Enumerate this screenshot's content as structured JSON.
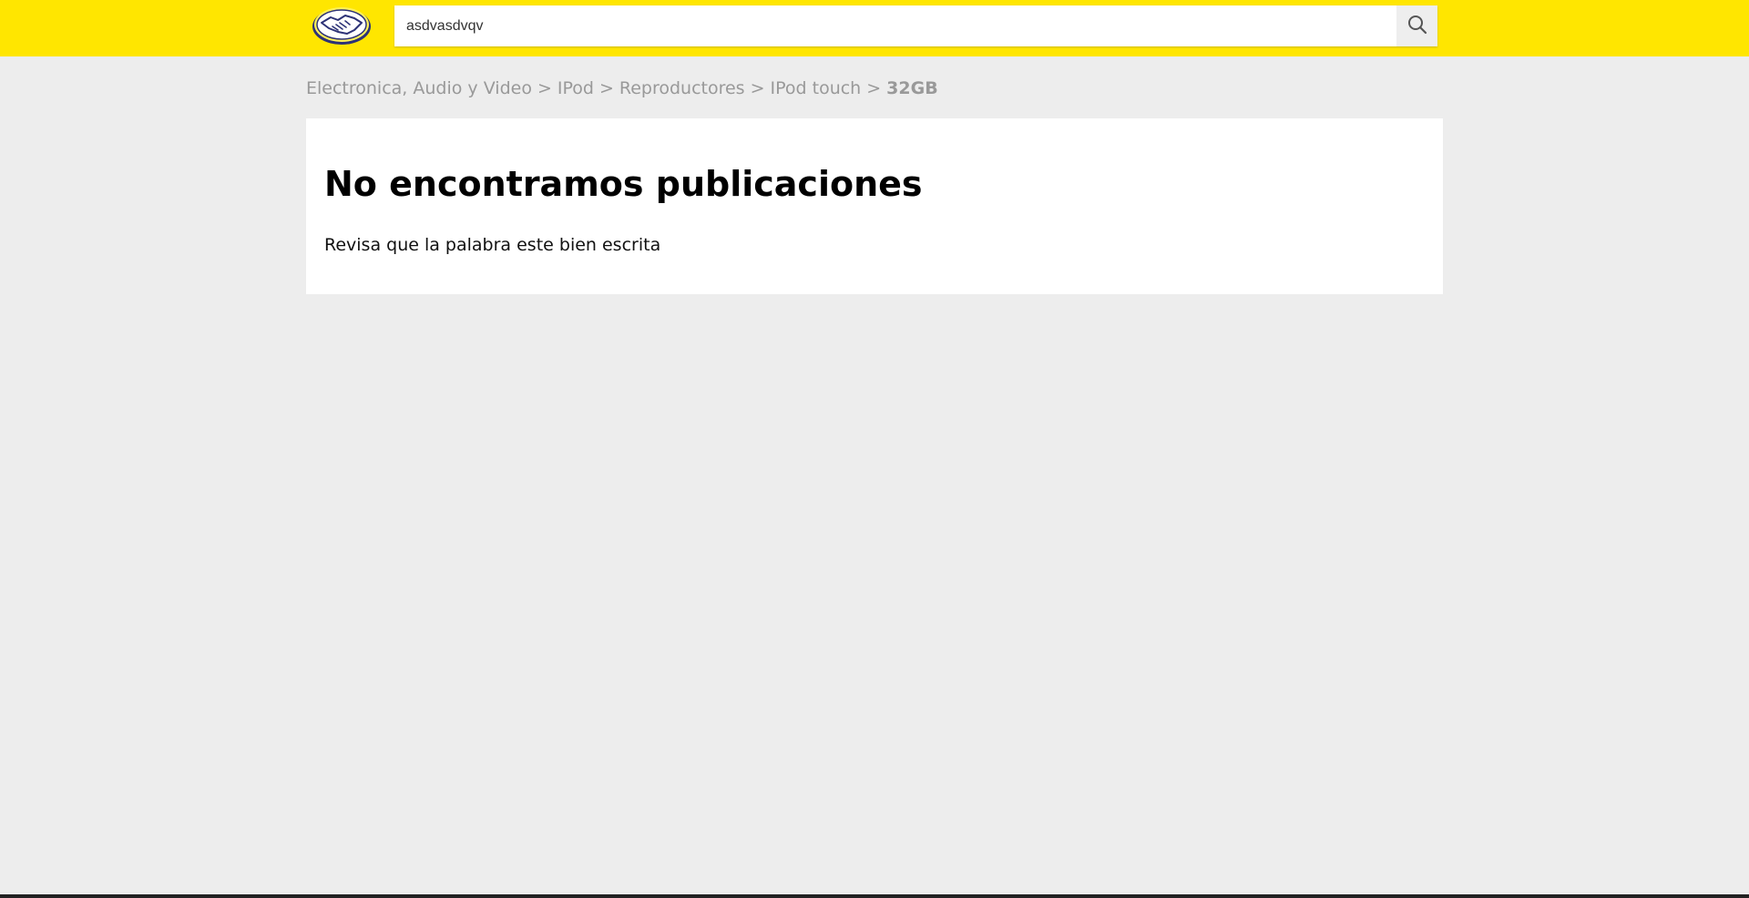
{
  "header": {
    "brand_color": "#ffe600",
    "logo_icon": "handshake-logo-icon",
    "search": {
      "value": "asdvasdvqv",
      "placeholder": "",
      "button_icon": "search-icon"
    }
  },
  "breadcrumb": {
    "items": [
      "Electronica, Audio y Video",
      "IPod",
      "Reproductores",
      "IPod touch"
    ],
    "separator": ">",
    "current": "32GB"
  },
  "results": {
    "title": "No encontramos publicaciones",
    "hint": "Revisa que la palabra este bien escrita"
  }
}
